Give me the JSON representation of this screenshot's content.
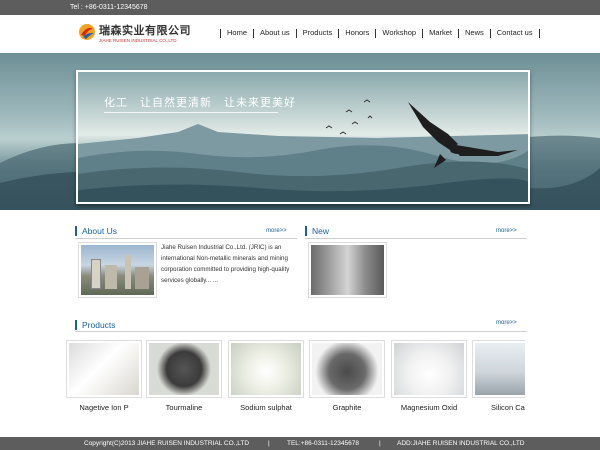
{
  "topbar": {
    "tel": "Tel : +86-0311-12345678"
  },
  "header": {
    "logo_cn": "瑞森实业有限公司",
    "logo_en": "JIAHE RUISEN INDUSTRIAL CO.,LTD"
  },
  "nav": {
    "items": [
      {
        "label": "Home"
      },
      {
        "label": "About us"
      },
      {
        "label": "Products"
      },
      {
        "label": "Honors"
      },
      {
        "label": "Workshop"
      },
      {
        "label": "Market"
      },
      {
        "label": "News"
      },
      {
        "label": "Contact us"
      }
    ]
  },
  "banner": {
    "slogan": "化工　让自然更清新　让未来更美好"
  },
  "about": {
    "title": "About Us",
    "more": "more>>",
    "text": "Jiahe Ruisen Industrial Co.,Ltd. (JRIC) is an international Non-metallic minerals and mining corporation committed to providing high-quality services globally... ..."
  },
  "news": {
    "title": "New",
    "more": "more>>"
  },
  "products": {
    "title": "Products",
    "more": "more>>",
    "items": [
      {
        "name": "Nagetive Ion P"
      },
      {
        "name": "Tourmaline"
      },
      {
        "name": "Sodium sulphat"
      },
      {
        "name": "Graphite"
      },
      {
        "name": "Magnesium Oxid"
      },
      {
        "name": "Silicon Carl"
      }
    ]
  },
  "footer": {
    "copyright": "Copyright(C)2013 JIAHE RUISEN INDUSTRIAL CO.,LTD",
    "divider": "|",
    "tel": "TEL:+86-0311-12345678",
    "addr": "ADD:JIAHE RUISEN INDUSTRIAL CO.,LTD"
  },
  "colors": {
    "accent": "#1a5fa0",
    "bar": "#5d5d5d"
  }
}
